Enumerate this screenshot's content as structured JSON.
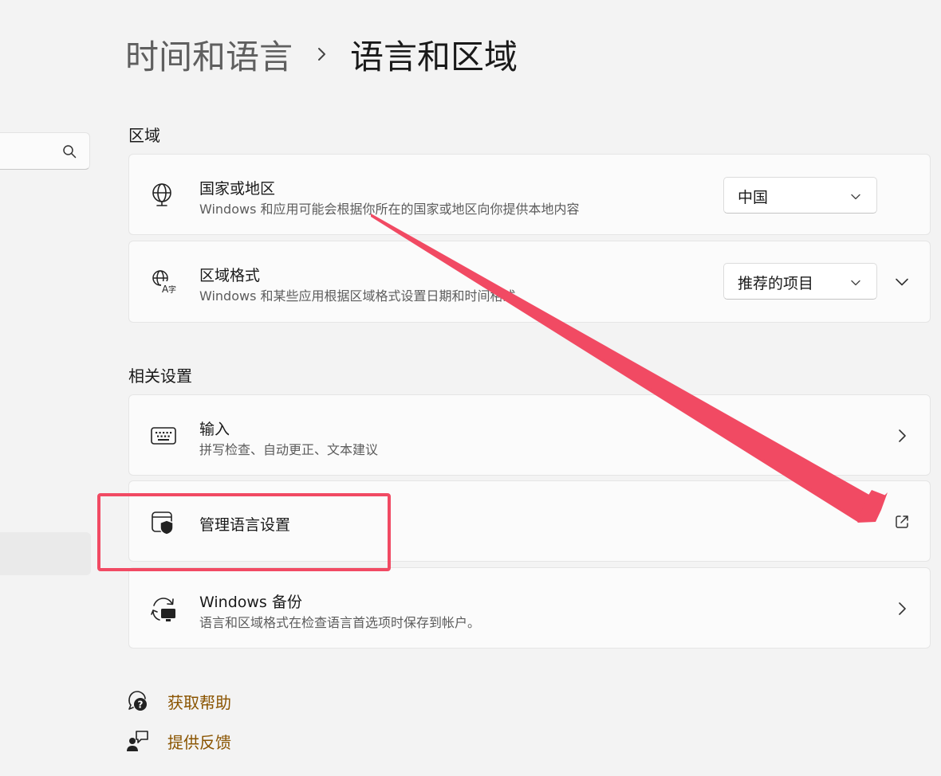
{
  "breadcrumb": {
    "parent": "时间和语言",
    "current": "语言和区域"
  },
  "sidebar": {
    "search_icon": "search-icon"
  },
  "region": {
    "section_title": "区域",
    "country": {
      "icon": "globe-icon",
      "title": "国家或地区",
      "description": "Windows 和应用可能会根据你所在的国家或地区向你提供本地内容",
      "selected": "中国"
    },
    "format": {
      "icon": "language-format-icon",
      "title": "区域格式",
      "description": "Windows 和某些应用根据区域格式设置日期和时间格式。",
      "selected": "推荐的项目"
    }
  },
  "related": {
    "section_title": "相关设置",
    "items": [
      {
        "icon": "keyboard-icon",
        "title": "输入",
        "description": "拼写检查、自动更正、文本建议"
      },
      {
        "icon": "admin-shield-window-icon",
        "title": "管理语言设置",
        "description": ""
      },
      {
        "icon": "backup-sync-icon",
        "title": "Windows 备份",
        "description": "语言和区域格式在检查语言首选项时保存到帐户。"
      }
    ]
  },
  "footer": {
    "help": "获取帮助",
    "feedback": "提供反馈"
  },
  "colors": {
    "annotation": "#f14a63",
    "link": "#8a5400",
    "background": "#f3f3f3",
    "card": "#fbfbfb"
  }
}
